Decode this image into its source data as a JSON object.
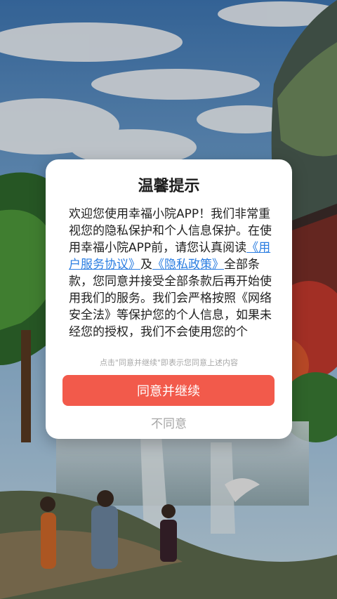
{
  "dialog": {
    "title": "温馨提示",
    "body": [
      {
        "text": "欢迎您使用幸福小院APP！我们非常重视您的隐私保护和个人信息保护。在使用幸福小院APP前，请您认真阅读"
      },
      {
        "text": "《用户服务协议》",
        "link": true
      },
      {
        "text": "及"
      },
      {
        "text": "《隐私政策》",
        "link": true
      },
      {
        "text": "全部条款，您同意并接受全部条款后再开始使用我们的服务。我们会严格按照《网络安全法》等保护您的个人信息，如果未经您的授权，我们不会使用您的个"
      }
    ],
    "hint": "点击\"同意并继续\"即表示您同意上述内容",
    "agree_label": "同意并继续",
    "disagree_label": "不同意"
  },
  "colors": {
    "accent": "#f25a4b",
    "link": "#2a7de1"
  }
}
